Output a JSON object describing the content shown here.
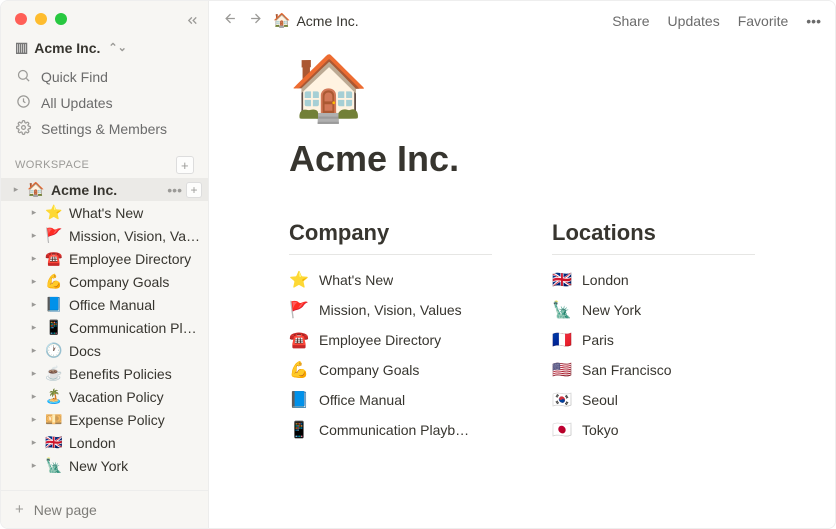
{
  "workspace": {
    "name": "Acme Inc.",
    "icon": "🏢"
  },
  "sidebar": {
    "quick_find": "Quick Find",
    "all_updates": "All Updates",
    "settings": "Settings & Members",
    "section_label": "WORKSPACE",
    "new_page": "New page",
    "root": {
      "icon": "🏠",
      "label": "Acme Inc."
    },
    "children": [
      {
        "icon": "⭐",
        "label": "What's New"
      },
      {
        "icon": "🚩",
        "label": "Mission, Vision, Valu…"
      },
      {
        "icon": "☎️",
        "label": "Employee Directory"
      },
      {
        "icon": "💪",
        "label": "Company Goals"
      },
      {
        "icon": "📘",
        "label": "Office Manual"
      },
      {
        "icon": "📱",
        "label": "Communication Play…"
      },
      {
        "icon": "🕐",
        "label": "Docs"
      },
      {
        "icon": "☕",
        "label": "Benefits Policies"
      },
      {
        "icon": "🏝️",
        "label": "Vacation Policy"
      },
      {
        "icon": "💴",
        "label": "Expense Policy"
      },
      {
        "icon": "🇬🇧",
        "label": "London"
      },
      {
        "icon": "🗽",
        "label": "New York"
      }
    ]
  },
  "topbar": {
    "breadcrumb_icon": "🏠",
    "breadcrumb": "Acme Inc.",
    "share": "Share",
    "updates": "Updates",
    "favorite": "Favorite"
  },
  "page": {
    "icon": "🏠",
    "title": "Acme Inc.",
    "company_heading": "Company",
    "locations_heading": "Locations",
    "company_links": [
      {
        "icon": "⭐",
        "label": "What's New"
      },
      {
        "icon": "🚩",
        "label": "Mission, Vision, Values"
      },
      {
        "icon": "☎️",
        "label": "Employee Directory"
      },
      {
        "icon": "💪",
        "label": "Company Goals"
      },
      {
        "icon": "📘",
        "label": "Office Manual"
      },
      {
        "icon": "📱",
        "label": "Communication Playb…"
      }
    ],
    "location_links": [
      {
        "icon": "🇬🇧",
        "label": "London"
      },
      {
        "icon": "🗽",
        "label": "New York"
      },
      {
        "icon": "🇫🇷",
        "label": "Paris"
      },
      {
        "icon": "🇺🇸",
        "label": "San Francisco"
      },
      {
        "icon": "🇰🇷",
        "label": "Seoul"
      },
      {
        "icon": "🇯🇵",
        "label": "Tokyo"
      }
    ]
  }
}
